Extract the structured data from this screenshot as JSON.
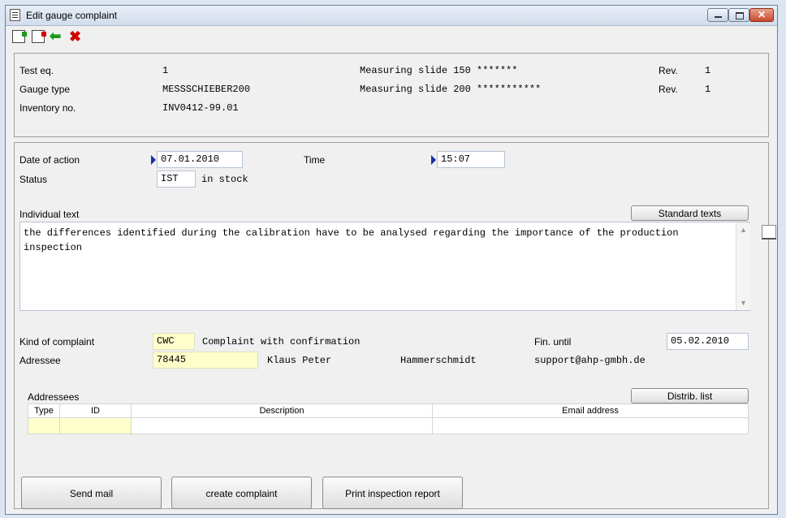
{
  "window": {
    "title": "Edit gauge complaint"
  },
  "header": {
    "rows": [
      {
        "label": "Test eq.",
        "value": "1",
        "desc": "Measuring slide 150 *******",
        "rev_label": "Rev.",
        "rev_value": "1"
      },
      {
        "label": "Gauge type",
        "value": "MESSSCHIEBER200",
        "desc": "Measuring slide 200 ***********",
        "rev_label": "Rev.",
        "rev_value": "1"
      },
      {
        "label": "Inventory no.",
        "value": "INV0412-99.01"
      }
    ]
  },
  "action": {
    "date_label": "Date of action",
    "date_value": "07.01.2010",
    "time_label": "Time",
    "time_value": "15:07",
    "status_label": "Status",
    "status_code": "IST",
    "status_text": "in stock"
  },
  "individual_text": {
    "label": "Individual text",
    "standard_texts_button": "Standard texts",
    "text": "the differences identified during the calibration have to be analysed regarding the importance of the production inspection"
  },
  "complaint": {
    "kind_label": "Kind of complaint",
    "kind_code": "CWC",
    "kind_text": "Complaint with confirmation",
    "fin_label": "Fin. until",
    "fin_value": "05.02.2010",
    "adressee_label": "Adressee",
    "adressee_id": "78445",
    "adressee_first": "Klaus Peter",
    "adressee_last": "Hammerschmidt",
    "adressee_email": "support@ahp-gmbh.de"
  },
  "addressees": {
    "label": "Addressees",
    "distrib_button": "Distrib. list",
    "columns": [
      "Type",
      "ID",
      "Description",
      "Email address"
    ]
  },
  "buttons": {
    "send_mail": "Send mail",
    "create_complaint": "create complaint",
    "print_report": "Print inspection report"
  },
  "colors": {
    "accent": "#1c2fa0",
    "highlight_field": "#ffffcc"
  }
}
